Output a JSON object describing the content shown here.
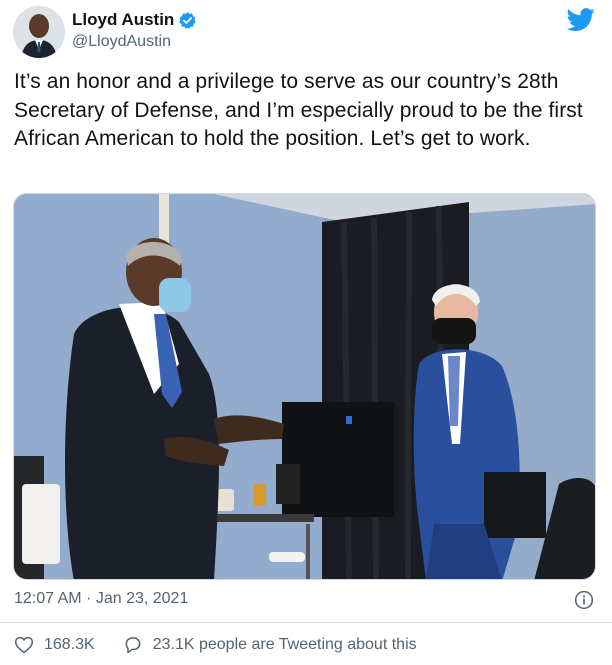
{
  "author": {
    "name": "Lloyd Austin",
    "handle": "@LloydAustin",
    "verified": true
  },
  "tweet": {
    "text": "It’s an honor and a privilege to serve as our country’s 28th Secretary of Defense, and I’m especially proud to be the first African American to hold the position. Let’s get to work.",
    "timestamp": "12:07 AM · Jan 23, 2021"
  },
  "stats": {
    "likes": "168.3K",
    "tweeting": "23.1K people are Tweeting about this"
  },
  "colors": {
    "twitter_blue": "#1d9bf0",
    "secondary_text": "#536471",
    "like_icon": "#536471"
  },
  "icons": [
    "verified-badge-icon",
    "twitter-bird-icon",
    "info-icon",
    "heart-icon",
    "reply-bubble-icon"
  ]
}
